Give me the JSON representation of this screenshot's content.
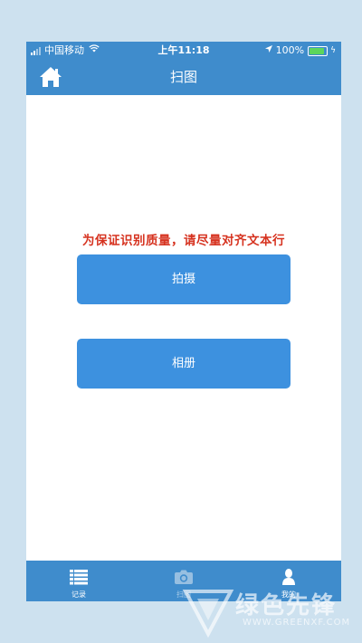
{
  "status_bar": {
    "carrier": "中国移动",
    "time": "上午11:18",
    "battery_percent": "100%",
    "battery_level": 1.0
  },
  "nav": {
    "title": "扫图",
    "home_icon": "home-icon"
  },
  "content": {
    "notice": "为保证识别质量，请尽量对齐文本行",
    "shoot_button": "拍摄",
    "album_button": "相册"
  },
  "tabs": [
    {
      "label": "记录",
      "icon": "list-icon",
      "active": true
    },
    {
      "label": "扫图",
      "icon": "camera-icon",
      "active": false
    },
    {
      "label": "我的",
      "icon": "person-icon",
      "active": true
    }
  ],
  "watermark": {
    "text": "绿色先锋",
    "url": "WWW.GREENXF.COM"
  },
  "colors": {
    "bar_blue": "#3f8ccc",
    "button_blue": "#3d91df",
    "notice_red": "#d6321f",
    "page_bg": "#cde1ef"
  }
}
